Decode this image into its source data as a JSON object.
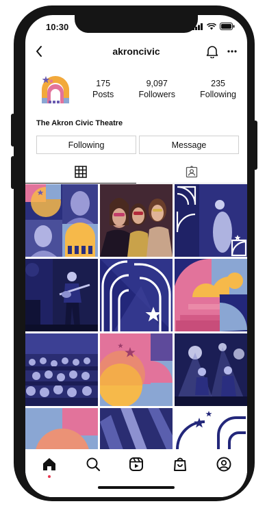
{
  "status": {
    "time": "10:30"
  },
  "header": {
    "username": "akroncivic"
  },
  "profile": {
    "display_name": "The Akron Civic Theatre",
    "stats": [
      {
        "value": "175",
        "label": "Posts"
      },
      {
        "value": "9,097",
        "label": "Followers"
      },
      {
        "value": "235",
        "label": "Following"
      }
    ]
  },
  "actions": {
    "following_label": "Following",
    "message_label": "Message"
  },
  "tabs": [
    {
      "icon": "grid-icon"
    },
    {
      "icon": "tagged-icon"
    }
  ],
  "nav": [
    {
      "icon": "home-icon"
    },
    {
      "icon": "search-icon"
    },
    {
      "icon": "reels-icon"
    },
    {
      "icon": "shop-icon"
    },
    {
      "icon": "profile-icon"
    }
  ],
  "colors": {
    "navy": "#23277a",
    "pink": "#e0739a",
    "yellow": "#f6b94a",
    "blue": "#8aa6d3",
    "purple": "#5e4a9b"
  }
}
